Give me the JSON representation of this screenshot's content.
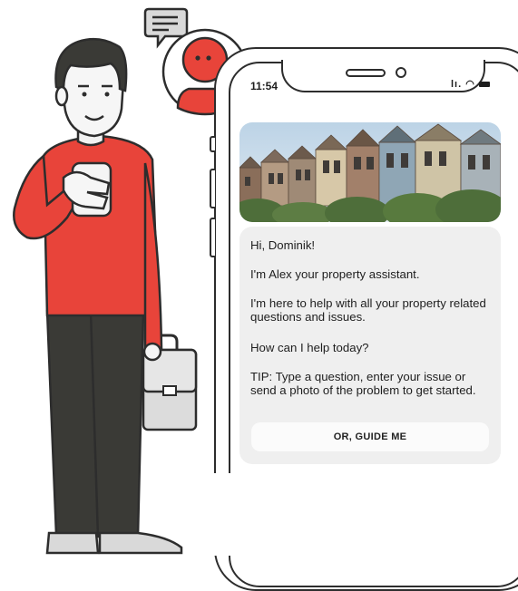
{
  "status_bar": {
    "time": "11:54",
    "icons": [
      "signal-icon",
      "wifi-icon",
      "battery-icon"
    ]
  },
  "hero_image": {
    "subject": "row of victorian houses",
    "sky_color": "#bcd3e6"
  },
  "chat": {
    "greeting": "Hi, Dominik!",
    "intro": "I'm Alex your property assistant.",
    "help": "I'm here to help with all your property related questions and issues.",
    "question": "How can I help today?",
    "tip": "TIP: Type a question, enter your issue or send a photo of the problem to get started.",
    "guide_button": "OR, GUIDE ME"
  },
  "colors": {
    "accent": "#e8443a",
    "outline": "#2d2d2d",
    "pants": "#3a3a36",
    "card_bg": "#efefef"
  }
}
